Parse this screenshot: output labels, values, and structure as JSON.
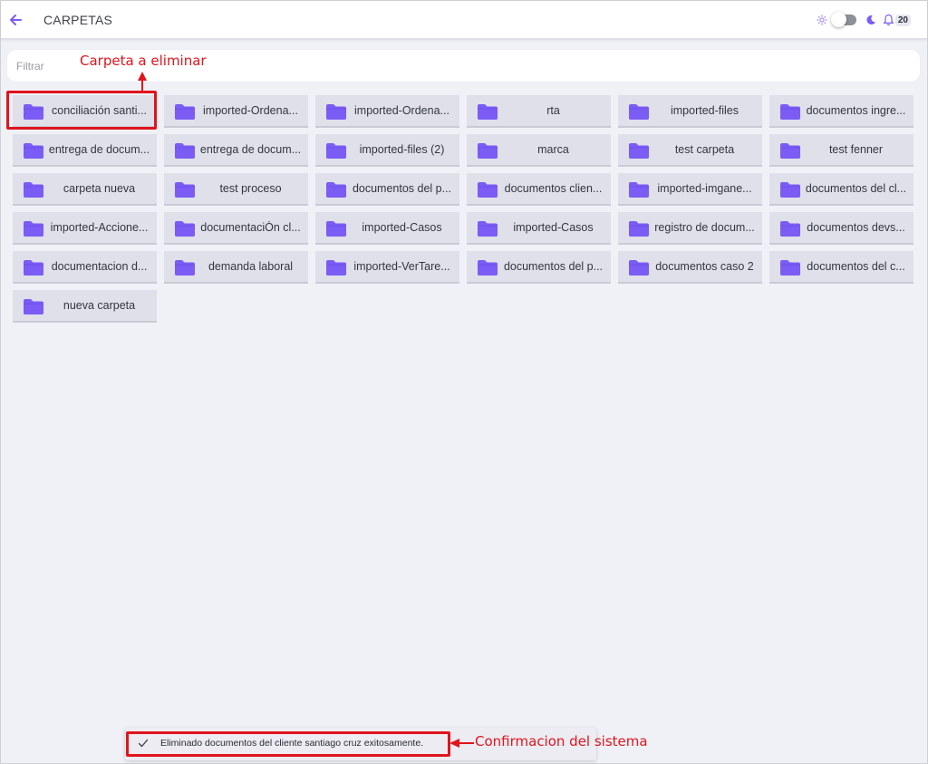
{
  "header": {
    "title": "CARPETAS",
    "notification_count": "20"
  },
  "filter": {
    "placeholder": "Filtrar",
    "value": ""
  },
  "folders": [
    "conciliación santi...",
    "imported-Ordena...",
    "imported-Ordena...",
    "rta",
    "imported-files",
    "documentos ingre...",
    "entrega de docum...",
    "entrega de docum...",
    "imported-files (2)",
    "marca",
    "test carpeta",
    "test fenner",
    "carpeta nueva",
    "test proceso",
    "documentos del p...",
    "documentos clien...",
    "imported-imgane...",
    "documentos del cl...",
    "imported-Accione...",
    "documentaciÓn cl...",
    "imported-Casos",
    "imported-Casos",
    "registro de docum...",
    "documentos devs...",
    "documentacion d...",
    "demanda laboral",
    "imported-VerTare...",
    "documentos del p...",
    "documentos caso 2",
    "documentos del c...",
    "nueva carpeta"
  ],
  "annotations": {
    "folder_to_delete": "Carpeta a eliminar",
    "system_confirmation": "Confirmacion del sistema"
  },
  "snackbar": {
    "message": "Eliminado documentos del cliente santiago cruz exitosamente."
  },
  "colors": {
    "accent": "#7b5cf5",
    "annotation": "#e0141c",
    "tile": "#dfe0ea",
    "background": "#f0f1f7"
  },
  "icons": {
    "back": "arrow-left-icon",
    "theme_light": "sun-icon",
    "theme_dark": "moon-icon",
    "notifications": "bell-icon",
    "folder": "folder-icon",
    "success": "check-icon"
  }
}
